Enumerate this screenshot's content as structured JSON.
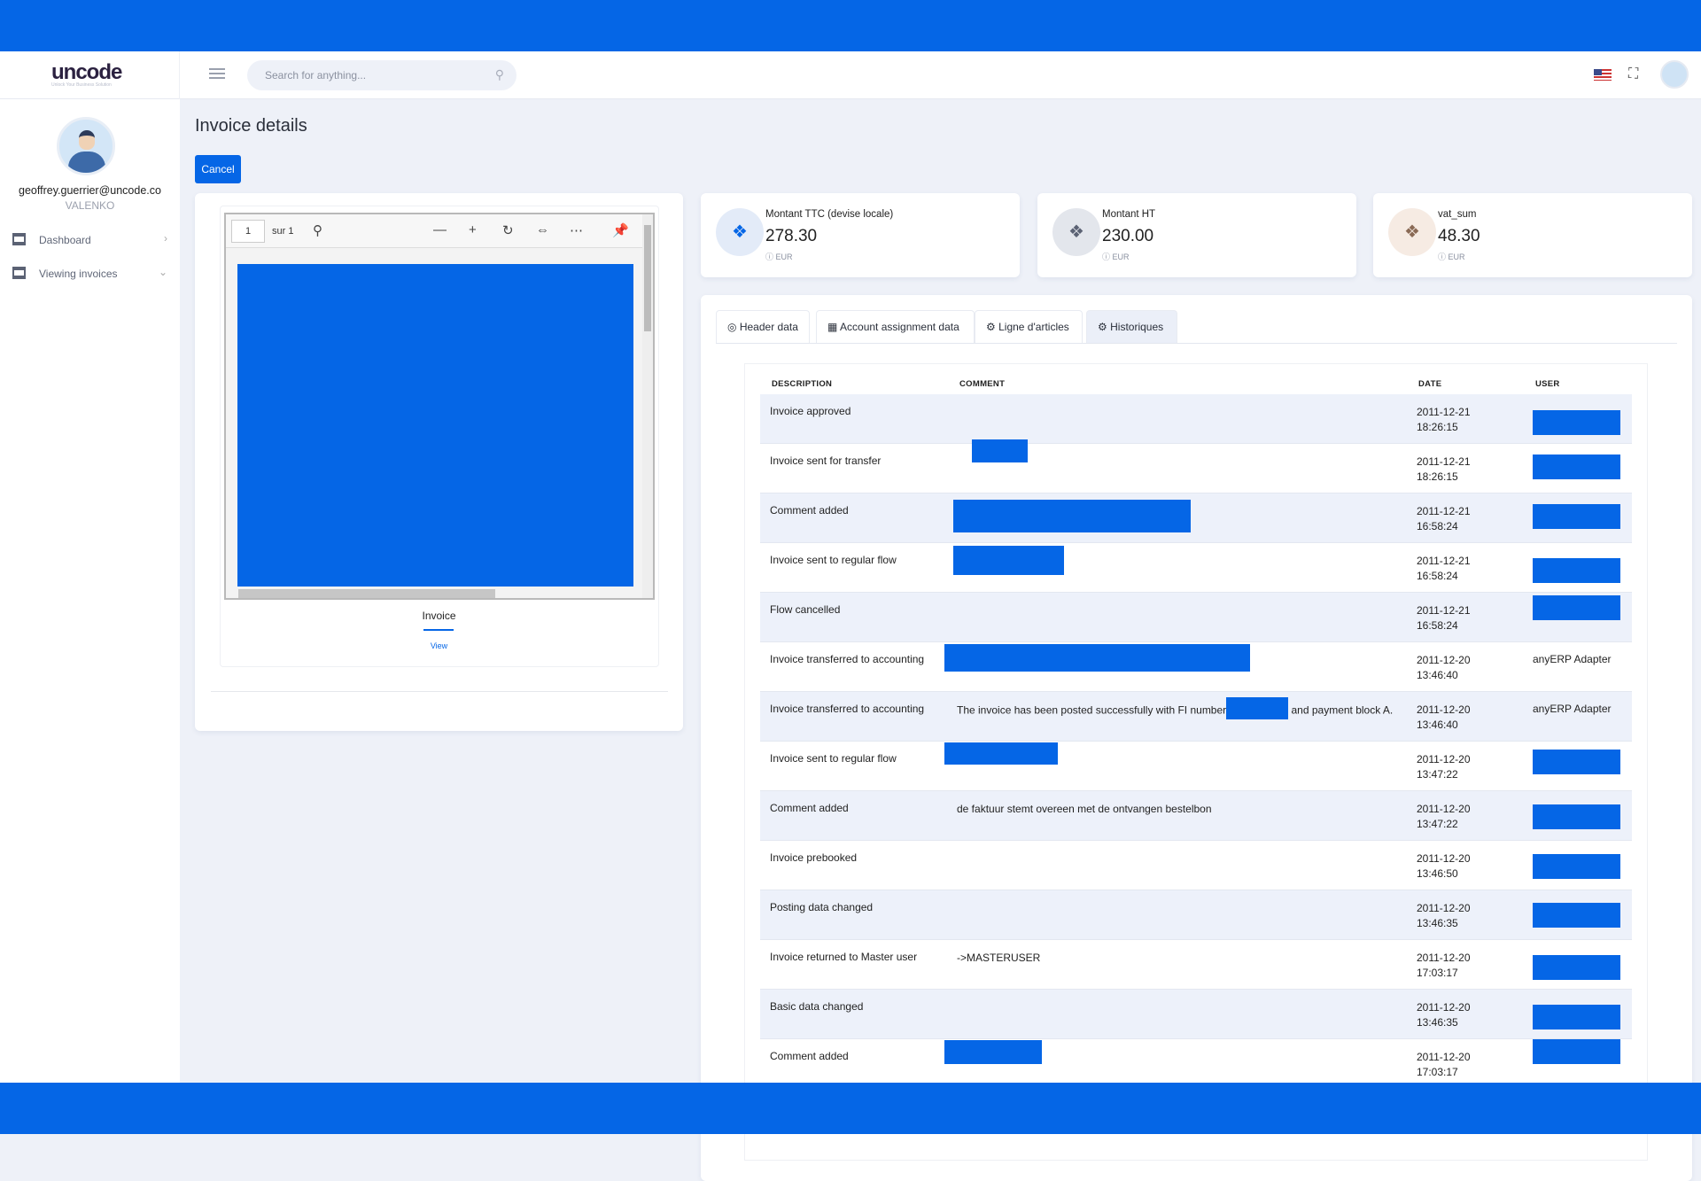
{
  "header": {
    "logo": "uncode",
    "tagline": "Unlock Your Business Solution",
    "search_placeholder": "Search for anything...",
    "icons": [
      "menu-icon",
      "search-icon",
      "us-flag-icon",
      "fullscreen-icon",
      "avatar"
    ]
  },
  "sidebar": {
    "email": "geoffrey.guerrier@uncode.co",
    "role": "VALENKO",
    "items": [
      {
        "label": "Dashboard",
        "icon": "server-icon",
        "chevron": "›"
      },
      {
        "label": "Viewing invoices",
        "icon": "server-icon",
        "chevron": "⌄"
      }
    ]
  },
  "page": {
    "title": "Invoice details",
    "cancel_label": "Cancel"
  },
  "viewer": {
    "page_number": "1",
    "page_total": "sur 1",
    "doc_label": "Invoice",
    "view_link": "View"
  },
  "stats": [
    {
      "label": "Montant TTC (devise locale)",
      "value": "278.30",
      "currency": "EUR",
      "color": "#0566e6"
    },
    {
      "label": "Montant HT",
      "value": "230.00",
      "currency": "EUR",
      "color": "#5b6274"
    },
    {
      "label": "vat_sum",
      "value": "48.30",
      "currency": "EUR",
      "color": "#8a6a55"
    }
  ],
  "tabs": [
    {
      "label": "Header data",
      "icon": "user-circle-icon"
    },
    {
      "label": "Account assignment data",
      "icon": "table-icon"
    },
    {
      "label": "Ligne d'articles",
      "icon": "gear-icon"
    },
    {
      "label": "Historiques",
      "icon": "gear-icon",
      "active": true
    }
  ],
  "table": {
    "columns": [
      "DESCRIPTION",
      "COMMENT",
      "DATE",
      "USER"
    ],
    "rows": [
      {
        "description": "Invoice approved",
        "comment": "",
        "date": "2011-12-21",
        "time": "18:26:15",
        "user": ""
      },
      {
        "description": "Invoice sent for transfer",
        "comment": "",
        "date": "2011-12-21",
        "time": "18:26:15",
        "user": ""
      },
      {
        "description": "Comment added",
        "comment": "",
        "date": "2011-12-21",
        "time": "16:58:24",
        "user": ""
      },
      {
        "description": "Invoice sent to regular flow",
        "comment": "",
        "date": "2011-12-21",
        "time": "16:58:24",
        "user": ""
      },
      {
        "description": "Flow cancelled",
        "comment": "",
        "date": "2011-12-21",
        "time": "16:58:24",
        "user": ""
      },
      {
        "description": "Invoice transferred to accounting",
        "comment": "",
        "date": "2011-12-20",
        "time": "13:46:40",
        "user": "anyERP Adapter"
      },
      {
        "description": "Invoice transferred to accounting",
        "comment": "The invoice has been posted successfully with FI number",
        "comment_after": "and payment block A.",
        "date": "2011-12-20",
        "time": "13:46:40",
        "user": "anyERP Adapter"
      },
      {
        "description": "Invoice sent to regular flow",
        "comment": "",
        "date": "2011-12-20",
        "time": "13:47:22",
        "user": ""
      },
      {
        "description": "Comment added",
        "comment": "de faktuur stemt overeen met de ontvangen bestelbon",
        "date": "2011-12-20",
        "time": "13:47:22",
        "user": ""
      },
      {
        "description": "Invoice prebooked",
        "comment": "",
        "date": "2011-12-20",
        "time": "13:46:50",
        "user": ""
      },
      {
        "description": "Posting data changed",
        "comment": "",
        "date": "2011-12-20",
        "time": "13:46:35",
        "user": ""
      },
      {
        "description": "Invoice returned to Master user",
        "comment": "->MASTERUSER",
        "date": "2011-12-20",
        "time": "17:03:17",
        "user": ""
      },
      {
        "description": "Basic data changed",
        "comment": "",
        "date": "2011-12-20",
        "time": "13:46:35",
        "user": ""
      },
      {
        "description": "Comment added",
        "comment": "",
        "date": "2011-12-20",
        "time": "17:03:17",
        "user": ""
      }
    ]
  },
  "colors": {
    "accent": "#0566e6",
    "background": "#eef1f8",
    "row_alt": "#edf1fa"
  }
}
